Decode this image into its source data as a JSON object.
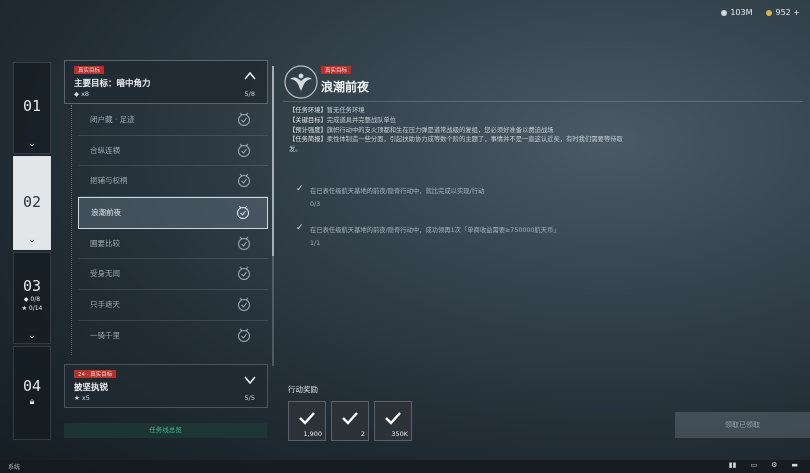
{
  "currency": {
    "left": "103M",
    "right": "952 +"
  },
  "chapters": [
    {
      "num": "01"
    },
    {
      "num": "02"
    },
    {
      "num": "03",
      "sub1": "◆ 0/8",
      "sub2": "★ 0/14"
    },
    {
      "num": "04"
    }
  ],
  "main_target": {
    "tag": "真实目标",
    "title": "主要目标：暗中角力",
    "sub": "◆ x8",
    "count": "5/8"
  },
  "missions": [
    {
      "label": "闭户藏 · 足迹"
    },
    {
      "label": "合纵连横"
    },
    {
      "label": "挹辅与权柄"
    },
    {
      "label": "浪潮前夜"
    },
    {
      "label": "圃要比较"
    },
    {
      "label": "受身无闻"
    },
    {
      "label": "只手遮天"
    },
    {
      "label": "一骑千里"
    }
  ],
  "chapter4_target": {
    "tag": "24 · 真实目标",
    "title": "披坚执锐",
    "sub": "★ x5",
    "count": "5/5"
  },
  "info_button": "任务线总览",
  "detail": {
    "tag": "真实目标",
    "title": "浪潮前夜",
    "info": [
      {
        "k": "【任务环境】",
        "v": "暂无任务环境"
      },
      {
        "k": "【关键目标】",
        "v": "完成道具并完整战队单位"
      },
      {
        "k": "【预计强度】",
        "v": "旗帜行动中的支火顶都和生在压力弹是道常战级的复组，您必须好准备以费迫战场"
      },
      {
        "k": "【任务简报】",
        "v": "柔性体制造一些分面，引起扶助协力成等数个阶的主题了，事情并不是一直这认近矣，有时我们需要等待取发。"
      }
    ],
    "objectives": [
      {
        "text": "在已表任级航天基地的前夜/隐奇行动中，就比完成以实现/行动",
        "progress": "0/3"
      },
      {
        "text": "在已表任级航天基地的前夜/隐奇行动中，成功领再1次「单商收益需要≥750000航天币」",
        "progress": "1/1"
      }
    ]
  },
  "rewards": {
    "title": "行动奖励",
    "items": [
      {
        "qty": "1,900"
      },
      {
        "qty": "2"
      },
      {
        "qty": "350K"
      }
    ]
  },
  "claim_button": "领取已领取",
  "bottom": {
    "left": "系统"
  }
}
